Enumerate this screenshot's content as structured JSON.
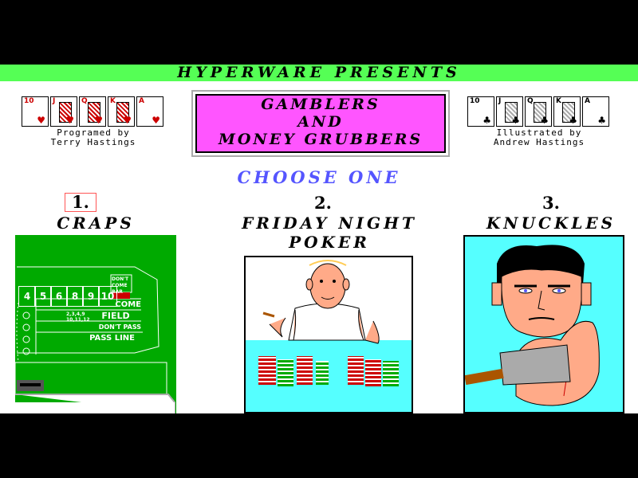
{
  "banner": {
    "title": "HYPERWARE PRESENTS"
  },
  "left_credit": {
    "cards": [
      {
        "rank": "10",
        "suit": "♥"
      },
      {
        "rank": "J",
        "suit": "♥"
      },
      {
        "rank": "Q",
        "suit": "♥"
      },
      {
        "rank": "K",
        "suit": "♥"
      },
      {
        "rank": "A",
        "suit": "♥"
      }
    ],
    "line1": "Programed by",
    "line2": "Terry Hastings"
  },
  "right_credit": {
    "cards": [
      {
        "rank": "10",
        "suit": "♣"
      },
      {
        "rank": "J",
        "suit": "♣"
      },
      {
        "rank": "Q",
        "suit": "♣"
      },
      {
        "rank": "K",
        "suit": "♣"
      },
      {
        "rank": "A",
        "suit": "♣"
      }
    ],
    "line1": "Illustrated by",
    "line2": "Andrew Hastings"
  },
  "title": {
    "line1": "GAMBLERS",
    "line2": "AND",
    "line3": "MONEY GRUBBERS"
  },
  "prompt": "CHOOSE ONE",
  "games": [
    {
      "number": "1.",
      "name_line1": "CRAPS",
      "name_line2": ""
    },
    {
      "number": "2.",
      "name_line1": "FRIDAY NIGHT",
      "name_line2": "POKER"
    },
    {
      "number": "3.",
      "name_line1": "KNUCKLES",
      "name_line2": ""
    }
  ],
  "craps_table": {
    "numbers": [
      "4",
      "5",
      "6",
      "8",
      "9",
      "10"
    ],
    "dont_come_bar": "DON'T COME BAR",
    "come": "COME",
    "field_numbers": "2,3,4,9 10,11,12",
    "field": "FIELD",
    "dont_pass": "DON'T PASS",
    "pass_line": "PASS LINE"
  },
  "colors": {
    "banner": "#55ff55",
    "title_box": "#ff55ff",
    "prompt": "#5555ff",
    "craps_felt": "#00aa00",
    "knuckles_bg": "#55ffff",
    "selection": "#ff5555"
  }
}
